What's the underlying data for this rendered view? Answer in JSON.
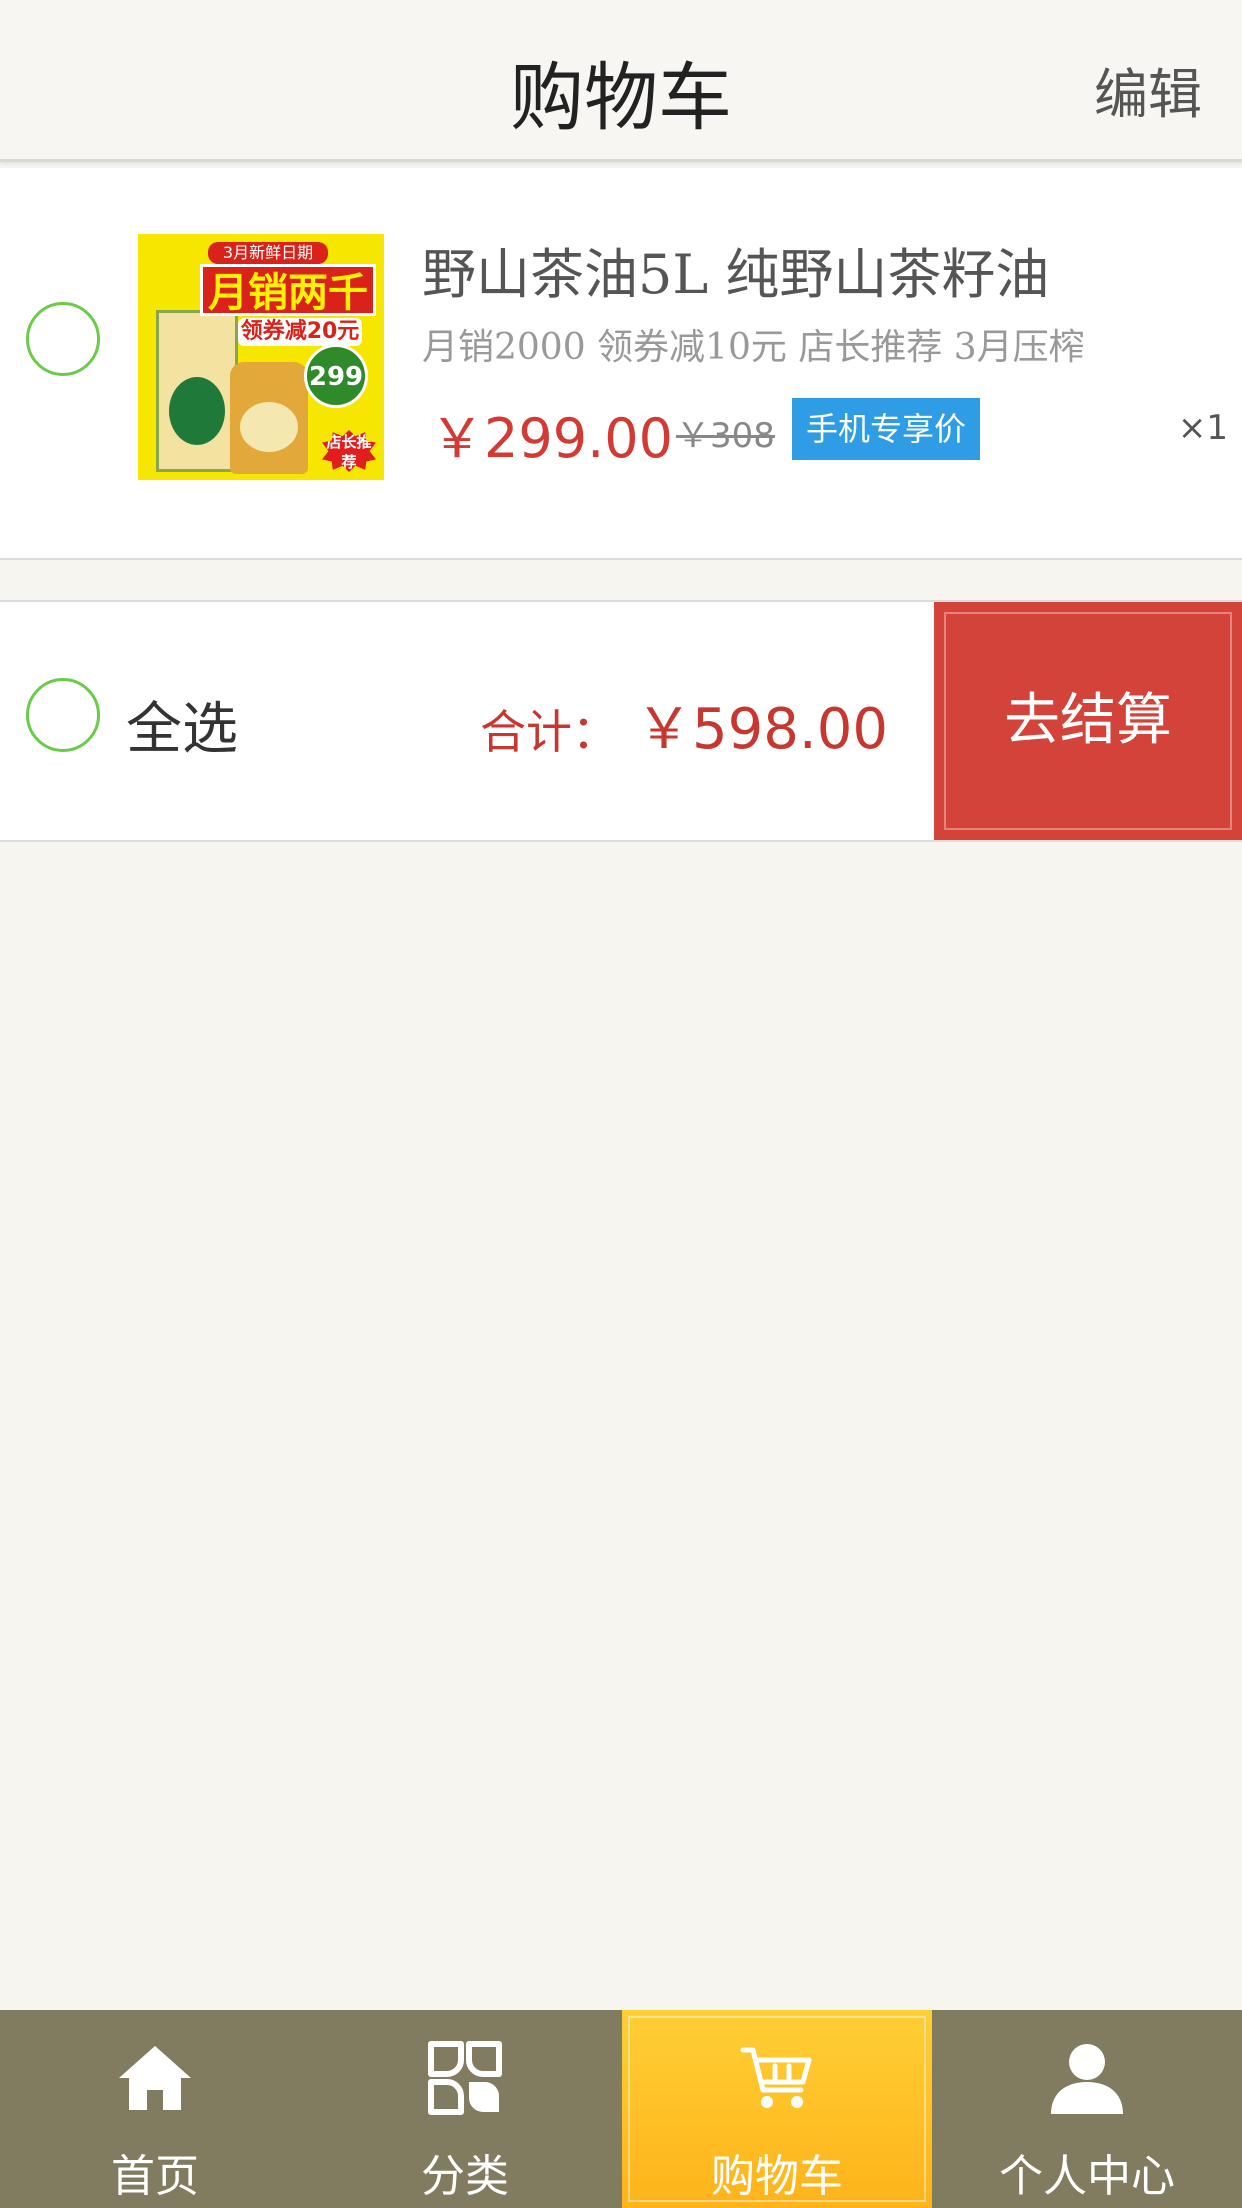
{
  "header": {
    "title": "购物车",
    "edit_label": "编辑"
  },
  "cart": {
    "items": [
      {
        "name": "野山茶油5L 纯野山茶籽油",
        "description": "月销2000 领券减10元 店长推荐 3月压榨",
        "price": "￥299.00",
        "original_price": "￥308",
        "badge": "手机专享价",
        "quantity": "×1",
        "image_text": {
          "top": "3月新鲜日期",
          "main": "月销两千",
          "sub": "领券减20元",
          "price": "299",
          "tag": "店长推荐"
        },
        "selected": false
      }
    ]
  },
  "checkout": {
    "select_all_label": "全选",
    "total_label": "合计：",
    "total_value": "￥598.00",
    "checkout_button": "去结算"
  },
  "tabbar": {
    "tabs": [
      {
        "label": "首页",
        "icon": "home-icon",
        "active": false
      },
      {
        "label": "分类",
        "icon": "category-icon",
        "active": false
      },
      {
        "label": "购物车",
        "icon": "cart-icon",
        "active": true
      },
      {
        "label": "个人中心",
        "icon": "user-icon",
        "active": false
      }
    ]
  },
  "colors": {
    "accent_red": "#d4433a",
    "price_red": "#c8372f",
    "badge_blue": "#2e9de6",
    "radio_green": "#6ccc4a",
    "tabbar_bg": "#817b60",
    "tab_active": "#ffbd24"
  }
}
